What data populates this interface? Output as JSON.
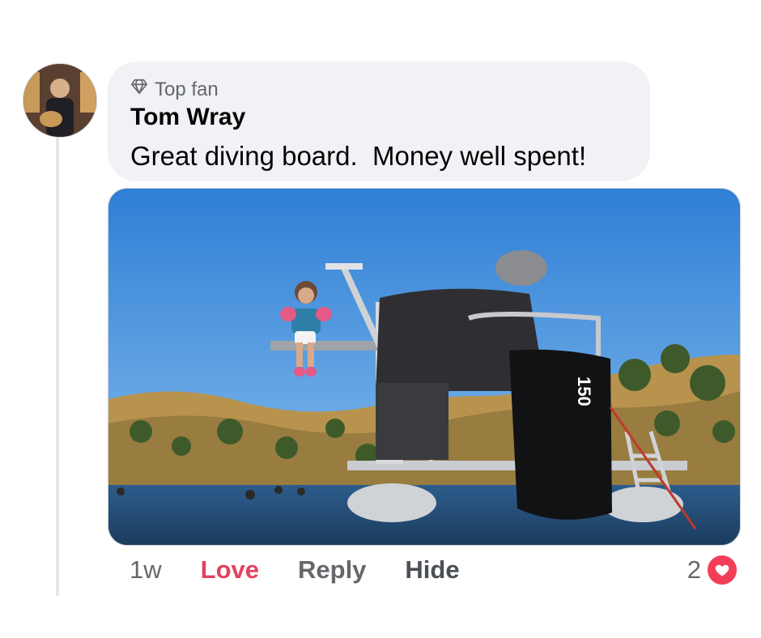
{
  "comment": {
    "badge_label": "Top fan",
    "author": "Tom Wray",
    "text": "Great diving board.  Money well spent!",
    "photo_alt": "Girl sitting on diving board of pontoon boat on a lake",
    "motor_label": "150"
  },
  "actions": {
    "time": "1w",
    "love": "Love",
    "reply": "Reply",
    "hide": "Hide"
  },
  "reactions": {
    "count": "2",
    "type": "love"
  },
  "colors": {
    "love": "#e4405f",
    "bubble": "#f0f2f5",
    "reaction_heart": "#f33e58"
  }
}
